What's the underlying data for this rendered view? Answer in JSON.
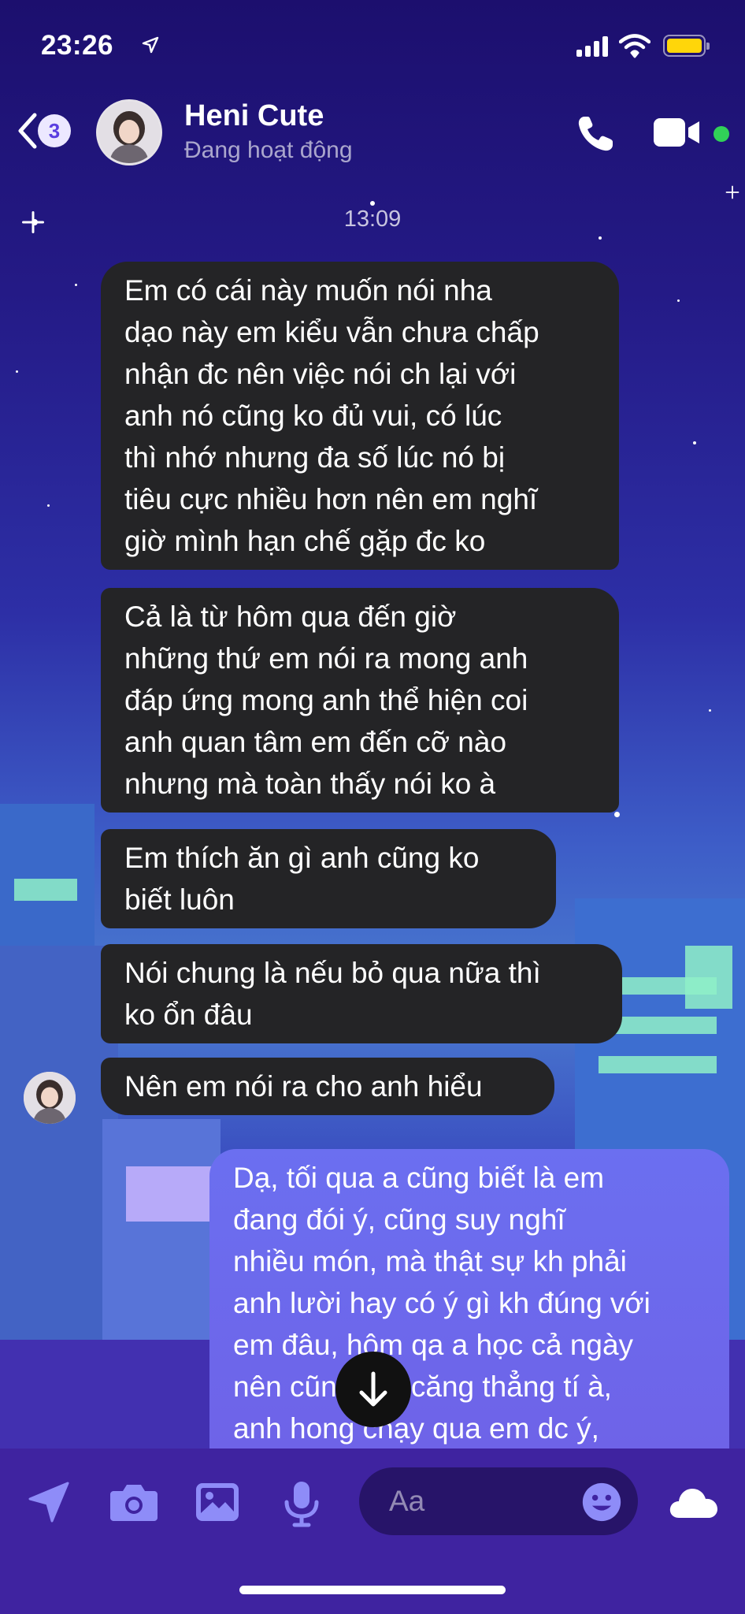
{
  "status_bar": {
    "time": "23:26"
  },
  "header": {
    "back_badge": "3",
    "contact_name": "Heni Cute",
    "contact_status": "Đang hoạt động"
  },
  "conversation": {
    "timestamp": "13:09",
    "messages": [
      {
        "sender": "contact",
        "text": "Em có cái này muốn nói nha\ndạo này em kiểu vẫn chưa chấp\nnhận đc nên việc nói ch lại với\nanh nó cũng ko đủ vui, có lúc\nthì nhớ nhưng đa số lúc nó bị\ntiêu cực nhiều hơn nên em nghĩ\ngiờ mình hạn chế gặp đc ko"
      },
      {
        "sender": "contact",
        "text": "Cả là từ hôm qua đến giờ\nnhững thứ em nói ra mong anh\nđáp ứng mong anh thể hiện coi\nanh quan tâm em đến cỡ nào\nnhưng mà toàn thấy nói ko à"
      },
      {
        "sender": "contact",
        "text": "Em thích ăn gì anh cũng ko\nbiết luôn"
      },
      {
        "sender": "contact",
        "text": "Nói chung là nếu bỏ qua nữa thì\nko ổn đâu"
      },
      {
        "sender": "contact",
        "text": "Nên em nói ra cho anh hiểu"
      },
      {
        "sender": "me",
        "text": "Dạ, tối qua a cũng biết là em\nđang đói ý, cũng suy nghĩ\nnhiều món, mà thật sự kh phải\nanh lười hay có ý gì kh đúng với\nem đâu, hôm qa a học cả ngày\nnên cũng hơi căng thẳng tí à,\nanh hong chạy qua em dc ý,"
      }
    ]
  },
  "composer": {
    "placeholder": "Aa"
  },
  "colors": {
    "incoming_bubble": "#242426",
    "outgoing_bubble": "#6b6ff0",
    "online": "#31d158",
    "battery": "#ffd60a"
  }
}
